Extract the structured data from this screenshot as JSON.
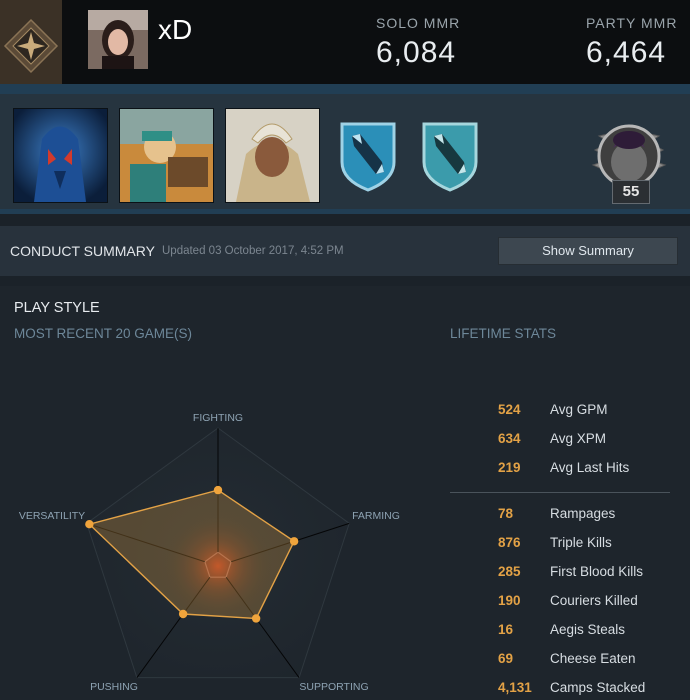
{
  "profile": {
    "name": "xD",
    "solo_mmr_label": "SOLO MMR",
    "solo_mmr": "6,084",
    "party_mmr_label": "PARTY MMR",
    "party_mmr": "6,464",
    "level": "55"
  },
  "heroes": [
    {
      "icon": "hero-portrait-blue-icon"
    },
    {
      "icon": "hero-portrait-tinker-icon"
    },
    {
      "icon": "hero-portrait-omniknight-icon"
    }
  ],
  "conduct": {
    "title": "CONDUCT SUMMARY",
    "updated": "Updated 03 October 2017, 4:52 PM",
    "button": "Show Summary"
  },
  "playstyle": {
    "title": "PLAY STYLE",
    "recent_label": "MOST RECENT 20 GAME(S)",
    "lifetime_label": "LIFETIME STATS",
    "axes": [
      "FIGHTING",
      "FARMING",
      "SUPPORTING",
      "PUSHING",
      "VERSATILITY"
    ],
    "values": [
      0.55,
      0.58,
      0.47,
      0.43,
      0.98
    ]
  },
  "stats_primary": [
    {
      "value": "524",
      "label": "Avg GPM"
    },
    {
      "value": "634",
      "label": "Avg XPM"
    },
    {
      "value": "219",
      "label": "Avg Last Hits"
    }
  ],
  "stats_secondary": [
    {
      "value": "78",
      "label": "Rampages"
    },
    {
      "value": "876",
      "label": "Triple Kills"
    },
    {
      "value": "285",
      "label": "First Blood Kills"
    },
    {
      "value": "190",
      "label": "Couriers Killed"
    },
    {
      "value": "16",
      "label": "Aegis Steals"
    },
    {
      "value": "69",
      "label": "Cheese Eaten"
    },
    {
      "value": "4,131",
      "label": "Camps Stacked"
    }
  ],
  "colors": {
    "accent_orange": "#e3a246",
    "label_blue": "#6d8799",
    "header_bg": "#0c0e10"
  }
}
